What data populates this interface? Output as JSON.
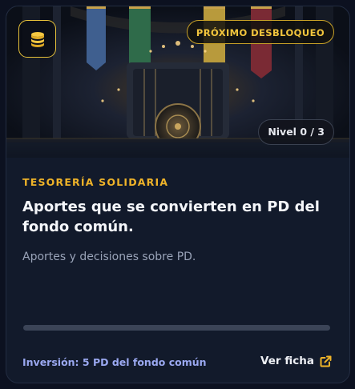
{
  "card": {
    "badge_unlock": "PRÓXIMO DESBLOQUEO",
    "badge_level": "Nivel 0 / 3",
    "category": "TESORERÍA SOLIDARIA",
    "title": "Aportes que se convierten en PD del fondo común.",
    "description": "Aportes y decisiones sobre PD.",
    "progress": 0,
    "investment": "Inversión: 5 PD del fondo común",
    "view_link": "Ver ficha"
  },
  "icons": {
    "coin": "coins-stack-icon",
    "link": "external-link-icon"
  },
  "colors": {
    "accent": "#f0b429",
    "investment_text": "#9aa8f0",
    "card_bg": "#121a2b"
  }
}
